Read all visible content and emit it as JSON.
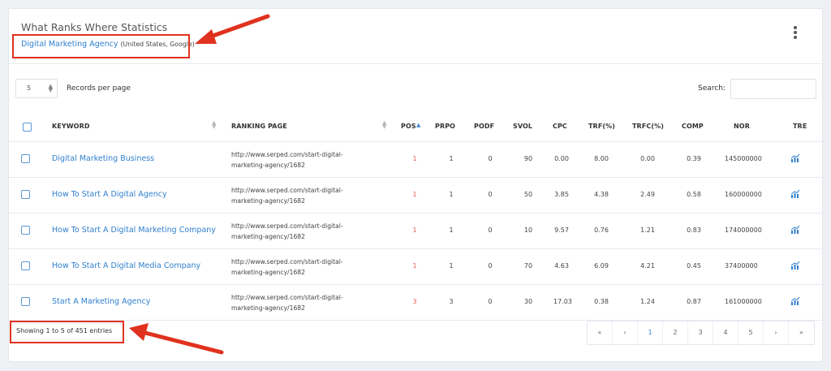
{
  "header": {
    "title": "What Ranks Where Statistics",
    "keyword": "Digital Marketing Agency",
    "meta": "(United States, Google)"
  },
  "controls": {
    "records_value": "5",
    "records_label": "Records per page",
    "search_label": "Search:",
    "search_value": ""
  },
  "table": {
    "columns": [
      "KEYWORD",
      "RANKING PAGE",
      "POS",
      "PRPO",
      "PODF",
      "SVOL",
      "CPC",
      "TRF(%)",
      "TRFC(%)",
      "COMP",
      "NOR",
      "TRE"
    ],
    "rows": [
      {
        "keyword": "Digital Marketing Business",
        "url1": "http://www.serped.com/start-digital-",
        "url2": "marketing-agency/1682",
        "pos": "1",
        "prpo": "1",
        "podf": "0",
        "svol": "90",
        "cpc": "0.00",
        "trf": "8.00",
        "trfc": "0.00",
        "comp": "0.39",
        "nor": "145000000"
      },
      {
        "keyword": "How To Start A Digital Agency",
        "url1": "http://www.serped.com/start-digital-",
        "url2": "marketing-agency/1682",
        "pos": "1",
        "prpo": "1",
        "podf": "0",
        "svol": "50",
        "cpc": "3.85",
        "trf": "4.38",
        "trfc": "2.49",
        "comp": "0.58",
        "nor": "160000000"
      },
      {
        "keyword": "How To Start A Digital Marketing Company",
        "url1": "http://www.serped.com/start-digital-",
        "url2": "marketing-agency/1682",
        "pos": "1",
        "prpo": "1",
        "podf": "0",
        "svol": "10",
        "cpc": "9.57",
        "trf": "0.76",
        "trfc": "1.21",
        "comp": "0.83",
        "nor": "174000000"
      },
      {
        "keyword": "How To Start A Digital Media Company",
        "url1": "http://www.serped.com/start-digital-",
        "url2": "marketing-agency/1682",
        "pos": "1",
        "prpo": "1",
        "podf": "0",
        "svol": "70",
        "cpc": "4.63",
        "trf": "6.09",
        "trfc": "4.21",
        "comp": "0.45",
        "nor": "37400000"
      },
      {
        "keyword": "Start A Marketing Agency",
        "url1": "http://www.serped.com/start-digital-",
        "url2": "marketing-agency/1682",
        "pos": "3",
        "prpo": "3",
        "podf": "0",
        "svol": "30",
        "cpc": "17.03",
        "trf": "0.38",
        "trfc": "1.24",
        "comp": "0.87",
        "nor": "161000000"
      }
    ]
  },
  "footer": {
    "showing": "Showing 1 to 5 of 451 entries",
    "pages": [
      "«",
      "‹",
      "1",
      "2",
      "3",
      "4",
      "5",
      "›",
      "»"
    ]
  },
  "colors": {
    "link": "#2f7fce",
    "position": "#e05b4f",
    "highlight": "#e0321e"
  },
  "icons": {
    "menu": "kebab-menu-icon",
    "trend": "trend-chart-icon",
    "sort": "sort-arrows-icon"
  }
}
